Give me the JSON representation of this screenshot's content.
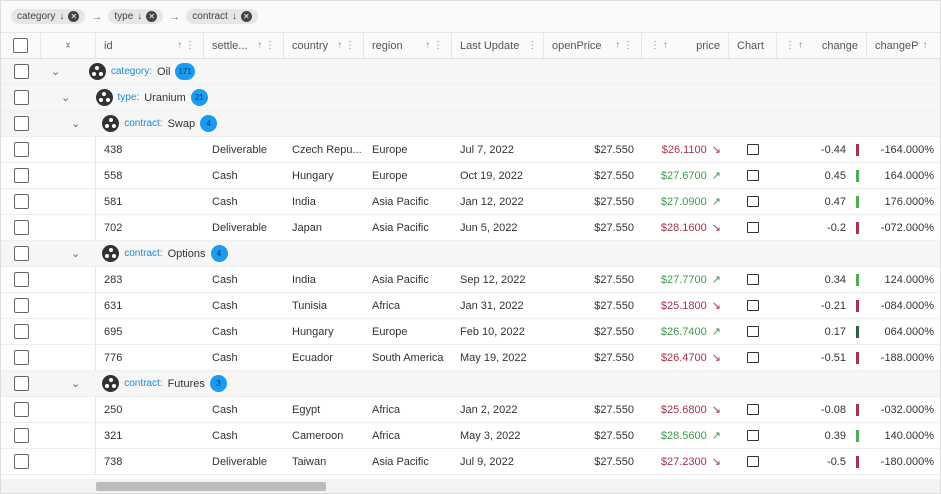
{
  "grouping": [
    {
      "label": "category"
    },
    {
      "label": "type"
    },
    {
      "label": "contract"
    }
  ],
  "columns": [
    "id",
    "settle...",
    "country",
    "region",
    "Last Update",
    "openPrice",
    "price",
    "Chart",
    "change",
    "changeP"
  ],
  "colors": {
    "negative": "#a8334a",
    "positive": "#3d9a4a",
    "badge": "#1a9bf0"
  },
  "groups": {
    "category": {
      "key": "category:",
      "value": "Oil",
      "count": "171"
    },
    "type": {
      "key": "type:",
      "value": "Uranium",
      "count": "21"
    }
  },
  "contracts": [
    {
      "key": "contract:",
      "value": "Swap",
      "count": "4",
      "rows": [
        {
          "id": "438",
          "settle": "Deliverable",
          "country": "Czech Repu...",
          "region": "Europe",
          "date": "Jul 7, 2022",
          "open": "$27.550",
          "price": "$26.1100",
          "dir": "down",
          "change": "-0.44",
          "changeP": "-164.000%"
        },
        {
          "id": "558",
          "settle": "Cash",
          "country": "Hungary",
          "region": "Europe",
          "date": "Oct 19, 2022",
          "open": "$27.550",
          "price": "$27.6700",
          "dir": "up",
          "change": "0.45",
          "changeP": "164.000%"
        },
        {
          "id": "581",
          "settle": "Cash",
          "country": "India",
          "region": "Asia Pacific",
          "date": "Jan 12, 2022",
          "open": "$27.550",
          "price": "$27.0900",
          "dir": "up",
          "change": "0.47",
          "changeP": "176.000%"
        },
        {
          "id": "702",
          "settle": "Deliverable",
          "country": "Japan",
          "region": "Asia Pacific",
          "date": "Jun 5, 2022",
          "open": "$27.550",
          "price": "$28.1600",
          "dir": "down",
          "change": "-0.2",
          "changeP": "-072.000%"
        }
      ]
    },
    {
      "key": "contract:",
      "value": "Options",
      "count": "4",
      "rows": [
        {
          "id": "283",
          "settle": "Cash",
          "country": "India",
          "region": "Asia Pacific",
          "date": "Sep 12, 2022",
          "open": "$27.550",
          "price": "$27.7700",
          "dir": "up",
          "change": "0.34",
          "changeP": "124.000%"
        },
        {
          "id": "631",
          "settle": "Cash",
          "country": "Tunisia",
          "region": "Africa",
          "date": "Jan 31, 2022",
          "open": "$27.550",
          "price": "$25.1800",
          "dir": "down",
          "change": "-0.21",
          "changeP": "-084.000%"
        },
        {
          "id": "695",
          "settle": "Cash",
          "country": "Hungary",
          "region": "Europe",
          "date": "Feb 10, 2022",
          "open": "$27.550",
          "price": "$26.7400",
          "dir": "up",
          "change": "0.17",
          "changeP": "064.000%"
        },
        {
          "id": "776",
          "settle": "Cash",
          "country": "Ecuador",
          "region": "South America",
          "date": "May 19, 2022",
          "open": "$27.550",
          "price": "$26.4700",
          "dir": "down",
          "change": "-0.51",
          "changeP": "-188.000%"
        }
      ]
    },
    {
      "key": "contract:",
      "value": "Futures",
      "count": "3",
      "rows": [
        {
          "id": "250",
          "settle": "Cash",
          "country": "Egypt",
          "region": "Africa",
          "date": "Jan 2, 2022",
          "open": "$27.550",
          "price": "$25.6800",
          "dir": "down",
          "change": "-0.08",
          "changeP": "-032.000%"
        },
        {
          "id": "321",
          "settle": "Cash",
          "country": "Cameroon",
          "region": "Africa",
          "date": "May 3, 2022",
          "open": "$27.550",
          "price": "$28.5600",
          "dir": "up",
          "change": "0.39",
          "changeP": "140.000%"
        },
        {
          "id": "738",
          "settle": "Deliverable",
          "country": "Taiwan",
          "region": "Asia Pacific",
          "date": "Jul 9, 2022",
          "open": "$27.550",
          "price": "$27.2300",
          "dir": "down",
          "change": "-0.5",
          "changeP": "-180.000%"
        }
      ]
    }
  ]
}
